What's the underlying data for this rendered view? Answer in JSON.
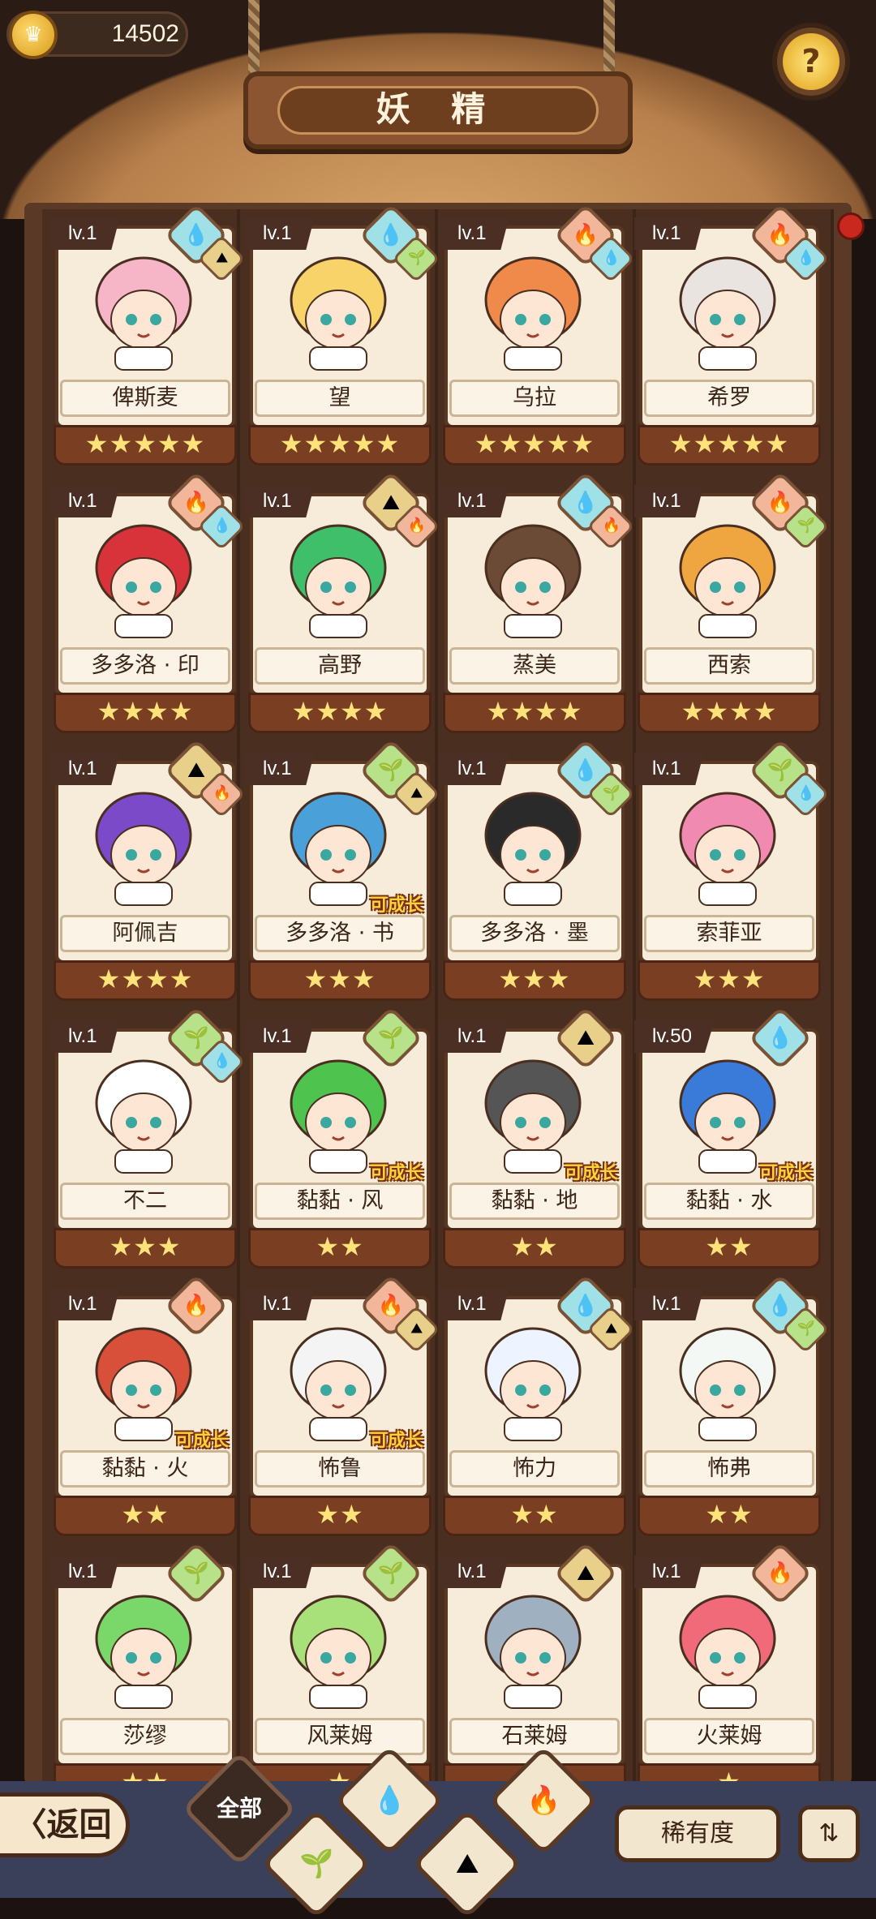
{
  "header": {
    "coin_value": "14502",
    "title": "妖 精",
    "coin_icon": "crown-coin-icon",
    "help_icon": "help-sprout-icon"
  },
  "fairies": [
    {
      "level": "lv.1",
      "name": "俾斯麦",
      "stars": "★★★★★",
      "elements": [
        "water",
        "earth"
      ],
      "grow": ""
    },
    {
      "level": "lv.1",
      "name": "望",
      "stars": "★★★★★",
      "elements": [
        "water",
        "plant"
      ],
      "grow": ""
    },
    {
      "level": "lv.1",
      "name": "乌拉",
      "stars": "★★★★★",
      "elements": [
        "fire",
        "water"
      ],
      "grow": ""
    },
    {
      "level": "lv.1",
      "name": "希罗",
      "stars": "★★★★★",
      "elements": [
        "fire",
        "water"
      ],
      "grow": ""
    },
    {
      "level": "lv.1",
      "name": "多多洛 · 印",
      "stars": "★★★★",
      "elements": [
        "fire",
        "water"
      ],
      "grow": ""
    },
    {
      "level": "lv.1",
      "name": "高野",
      "stars": "★★★★",
      "elements": [
        "earth",
        "fire"
      ],
      "grow": ""
    },
    {
      "level": "lv.1",
      "name": "蒸美",
      "stars": "★★★★",
      "elements": [
        "water",
        "fire"
      ],
      "grow": ""
    },
    {
      "level": "lv.1",
      "name": "西索",
      "stars": "★★★★",
      "elements": [
        "fire",
        "plant"
      ],
      "grow": ""
    },
    {
      "level": "lv.1",
      "name": "阿佩吉",
      "stars": "★★★★",
      "elements": [
        "earth",
        "fire"
      ],
      "grow": ""
    },
    {
      "level": "lv.1",
      "name": "多多洛 · 书",
      "stars": "★★★",
      "elements": [
        "plant",
        "earth"
      ],
      "grow": "可成长"
    },
    {
      "level": "lv.1",
      "name": "多多洛 · 墨",
      "stars": "★★★",
      "elements": [
        "water",
        "plant"
      ],
      "grow": ""
    },
    {
      "level": "lv.1",
      "name": "索菲亚",
      "stars": "★★★",
      "elements": [
        "plant",
        "water"
      ],
      "grow": ""
    },
    {
      "level": "lv.1",
      "name": "不二",
      "stars": "★★★",
      "elements": [
        "plant",
        "water"
      ],
      "grow": ""
    },
    {
      "level": "lv.1",
      "name": "黏黏 · 风",
      "stars": "★★",
      "elements": [
        "plant"
      ],
      "grow": "可成长"
    },
    {
      "level": "lv.1",
      "name": "黏黏 · 地",
      "stars": "★★",
      "elements": [
        "earth"
      ],
      "grow": "可成长"
    },
    {
      "level": "lv.50",
      "name": "黏黏 · 水",
      "stars": "★★",
      "elements": [
        "water"
      ],
      "grow": "可成长"
    },
    {
      "level": "lv.1",
      "name": "黏黏 · 火",
      "stars": "★★",
      "elements": [
        "fire"
      ],
      "grow": "可成长"
    },
    {
      "level": "lv.1",
      "name": "怖鲁",
      "stars": "★★",
      "elements": [
        "fire",
        "earth"
      ],
      "grow": "可成长"
    },
    {
      "level": "lv.1",
      "name": "怖力",
      "stars": "★★",
      "elements": [
        "water",
        "earth"
      ],
      "grow": ""
    },
    {
      "level": "lv.1",
      "name": "怖弗",
      "stars": "★★",
      "elements": [
        "water",
        "plant"
      ],
      "grow": ""
    },
    {
      "level": "lv.1",
      "name": "莎缪",
      "stars": "★★",
      "elements": [
        "plant"
      ],
      "grow": ""
    },
    {
      "level": "lv.1",
      "name": "风莱姆",
      "stars": "★",
      "elements": [
        "plant"
      ],
      "grow": ""
    },
    {
      "level": "lv.1",
      "name": "石莱姆",
      "stars": "★",
      "elements": [
        "earth"
      ],
      "grow": ""
    },
    {
      "level": "lv.1",
      "name": "火莱姆",
      "stars": "★",
      "elements": [
        "fire"
      ],
      "grow": ""
    }
  ],
  "bottom": {
    "back_label": "〈返回",
    "tab_all_label": "全部",
    "rarity_label": "稀有度",
    "sort_icon": "sort-icon",
    "filter_icons": [
      "plant-filter-icon",
      "water-filter-icon",
      "earth-filter-icon",
      "fire-filter-icon"
    ]
  },
  "colors": {
    "water": "#9fe1e6",
    "fire": "#f2b69a",
    "earth": "#e8cf8a",
    "plant": "#b7e28a"
  }
}
